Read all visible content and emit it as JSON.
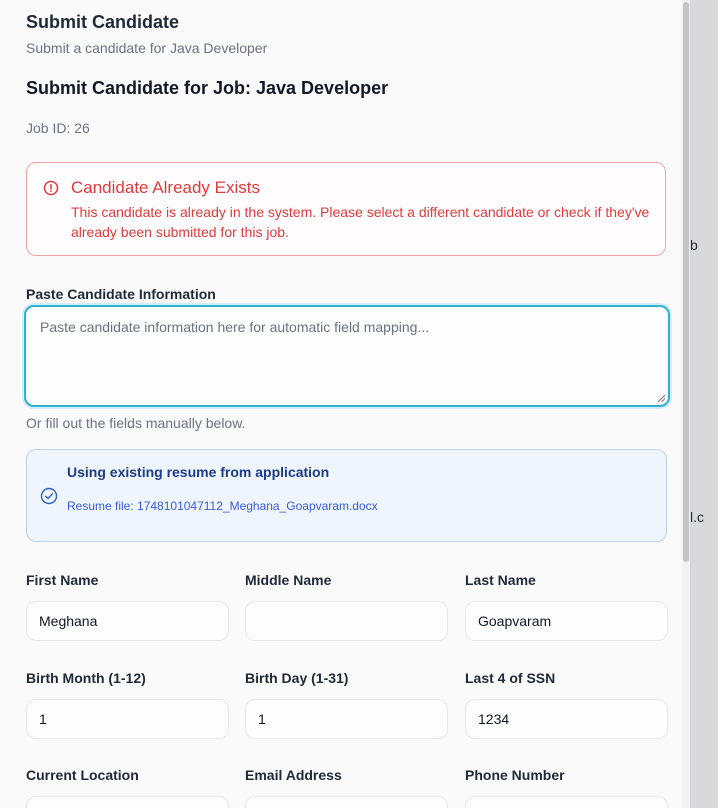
{
  "background": {
    "fragment_1": "b",
    "fragment_2": "l.c"
  },
  "dialog": {
    "title": "Submit Candidate",
    "subtitle": "Submit a candidate for Java Developer",
    "heading": "Submit Candidate for Job: Java Developer",
    "job_id": "Job ID: 26"
  },
  "alert": {
    "icon": "alert-circle-icon",
    "color": "#e03a3a",
    "title": "Candidate Already Exists",
    "message": "This candidate is already in the system. Please select a different candidate or check if they've already been submitted for this job."
  },
  "paste": {
    "label": "Paste Candidate Information",
    "placeholder": "Paste candidate information here for automatic field mapping...",
    "value": "",
    "manual_note": "Or fill out the fields manually below."
  },
  "resume": {
    "icon": "check-circle-icon",
    "title": "Using existing resume from application",
    "file": "Resume file: 1748101047112_Meghana_Goapvaram.docx"
  },
  "fields": {
    "first_name": {
      "label": "First Name",
      "value": "Meghana"
    },
    "middle_name": {
      "label": "Middle Name",
      "value": ""
    },
    "last_name": {
      "label": "Last Name",
      "value": "Goapvaram"
    },
    "birth_month": {
      "label": "Birth Month (1-12)",
      "value": "1"
    },
    "birth_day": {
      "label": "Birth Day (1-31)",
      "value": "1"
    },
    "ssn_last4": {
      "label": "Last 4 of SSN",
      "value": "1234"
    },
    "current_location": {
      "label": "Current Location",
      "value": ""
    },
    "email": {
      "label": "Email Address",
      "value": ""
    },
    "phone": {
      "label": "Phone Number",
      "value": ""
    }
  },
  "colors": {
    "accent": "#2fb0d6",
    "error": "#e03a3a",
    "info_bg": "#eef5fd"
  }
}
